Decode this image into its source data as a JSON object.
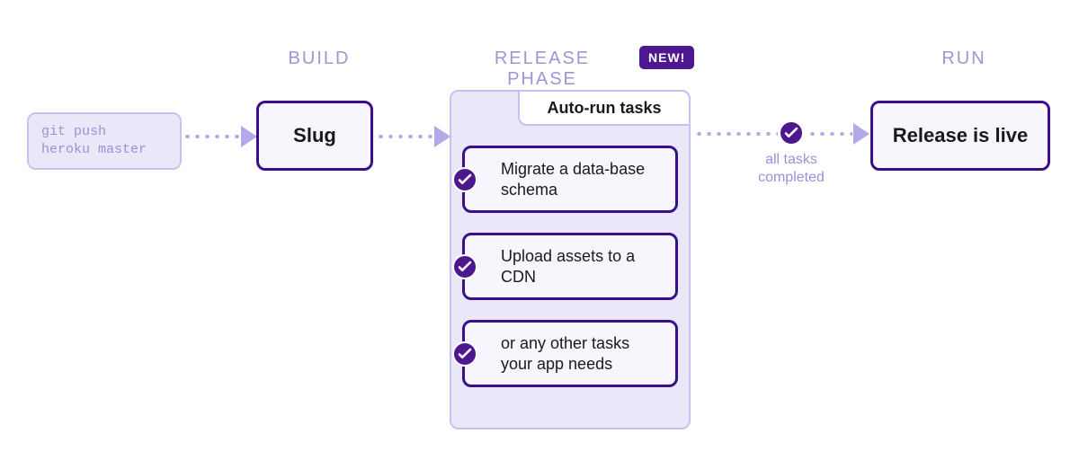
{
  "sections": {
    "build": "BUILD",
    "release": "RELEASE PHASE",
    "run": "RUN"
  },
  "badge": {
    "new": "NEW!"
  },
  "git_command": {
    "line1": "git push",
    "line2": "heroku master"
  },
  "slug_label": "Slug",
  "release": {
    "tab_label": "Auto-run tasks",
    "tasks": [
      "Migrate a data-base schema",
      "Upload assets to a CDN",
      "or any other tasks your app needs"
    ]
  },
  "completed_label_line1": "all tasks",
  "completed_label_line2": "completed",
  "run_label": "Release is live",
  "colors": {
    "accent_dark": "#3b0f8b",
    "accent_fill": "#4d188f",
    "lavender_bg": "#eae8f8",
    "lavender_border": "#c9c0ed",
    "light_text": "#9b8fd8",
    "panel_bg": "#f7f6fd"
  }
}
